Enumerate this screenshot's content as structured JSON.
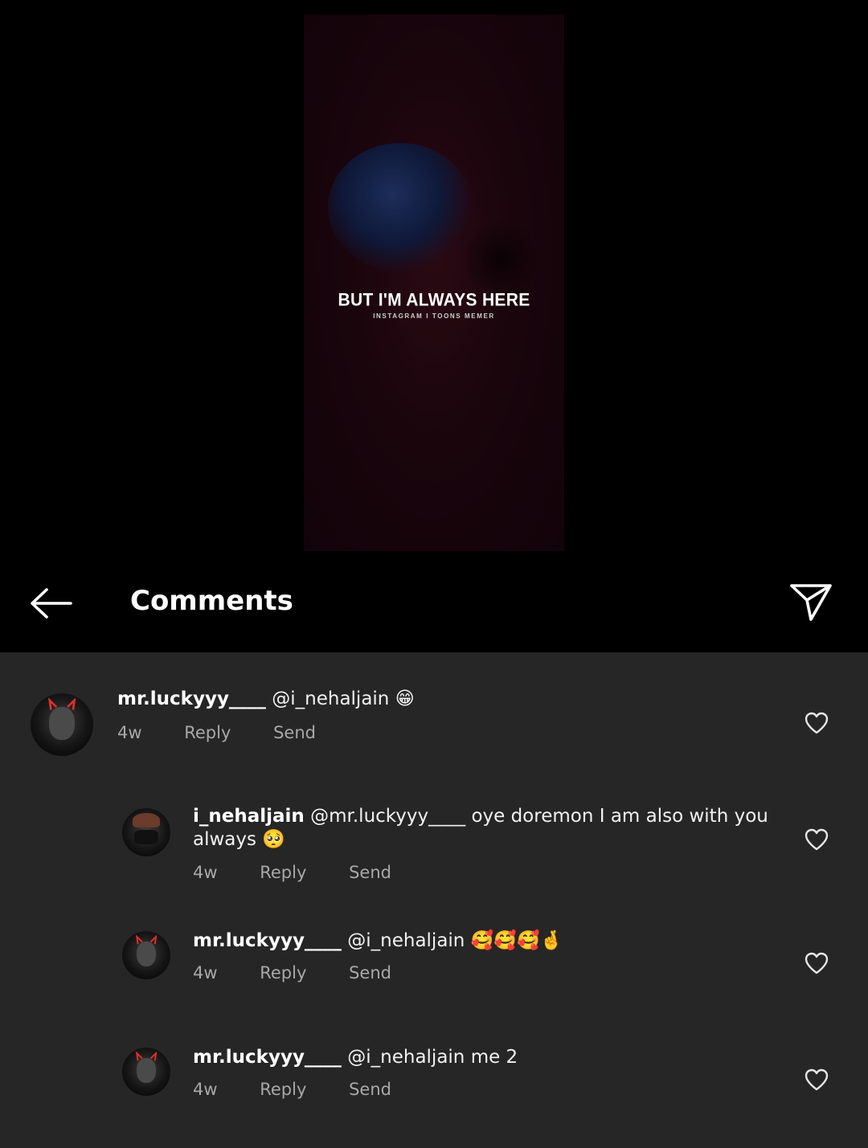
{
  "video": {
    "caption": "BUT I'M ALWAYS HERE",
    "watermark": "INSTAGRAM I TOONS MEMER"
  },
  "header": {
    "title": "Comments",
    "back_icon": "arrow-left-icon",
    "share_icon": "paper-plane-icon"
  },
  "colors": {
    "background": "#000000",
    "comments_panel": "#262626",
    "meta_text": "#a8a8a8"
  },
  "comments": [
    {
      "username": "mr.luckyyy____",
      "text": "@i_nehaljain",
      "emoji": "😁",
      "time": "4w",
      "reply_label": "Reply",
      "send_label": "Send"
    },
    {
      "username": "i_nehaljain",
      "text": "@mr.luckyyy____ oye doremon  I am also with you always",
      "emoji": "🥺",
      "time": "4w",
      "reply_label": "Reply",
      "send_label": "Send"
    },
    {
      "username": "mr.luckyyy____",
      "text": "@i_nehaljain",
      "emoji": "🥰🥰🥰🤞",
      "time": "4w",
      "reply_label": "Reply",
      "send_label": "Send"
    },
    {
      "username": "mr.luckyyy____",
      "text": "@i_nehaljain me 2",
      "emoji": "",
      "time": "4w",
      "reply_label": "Reply",
      "send_label": "Send"
    }
  ]
}
